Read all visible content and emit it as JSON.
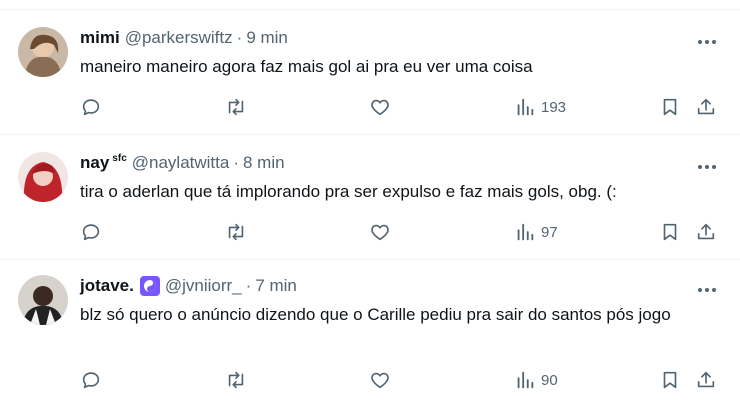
{
  "tweets": [
    {
      "name": "mimi",
      "badge_text": "",
      "handle": "@parkerswiftz",
      "time": "9 min",
      "text": "maneiro maneiro agora faz mais gol ai pra eu ver uma coisa",
      "views": "193"
    },
    {
      "name": "nay",
      "badge_text": "sfc",
      "handle": "@naylatwitta",
      "time": "8 min",
      "text": "tira o aderlan que tá implorando pra ser expulso e faz mais gols, obg. (:",
      "views": "97"
    },
    {
      "name": "jotave.",
      "badge_text": "",
      "handle": "@jvniiorr_",
      "time": "7 min",
      "text": "blz só quero o anúncio dizendo que o Carille pediu pra sair do santos pós jogo",
      "views": "90"
    }
  ],
  "separator": "·",
  "colors": {
    "secondary_text": "#536471",
    "primary_text": "#0f1419",
    "divider": "#eff3f4",
    "badge": "#7856ff"
  }
}
